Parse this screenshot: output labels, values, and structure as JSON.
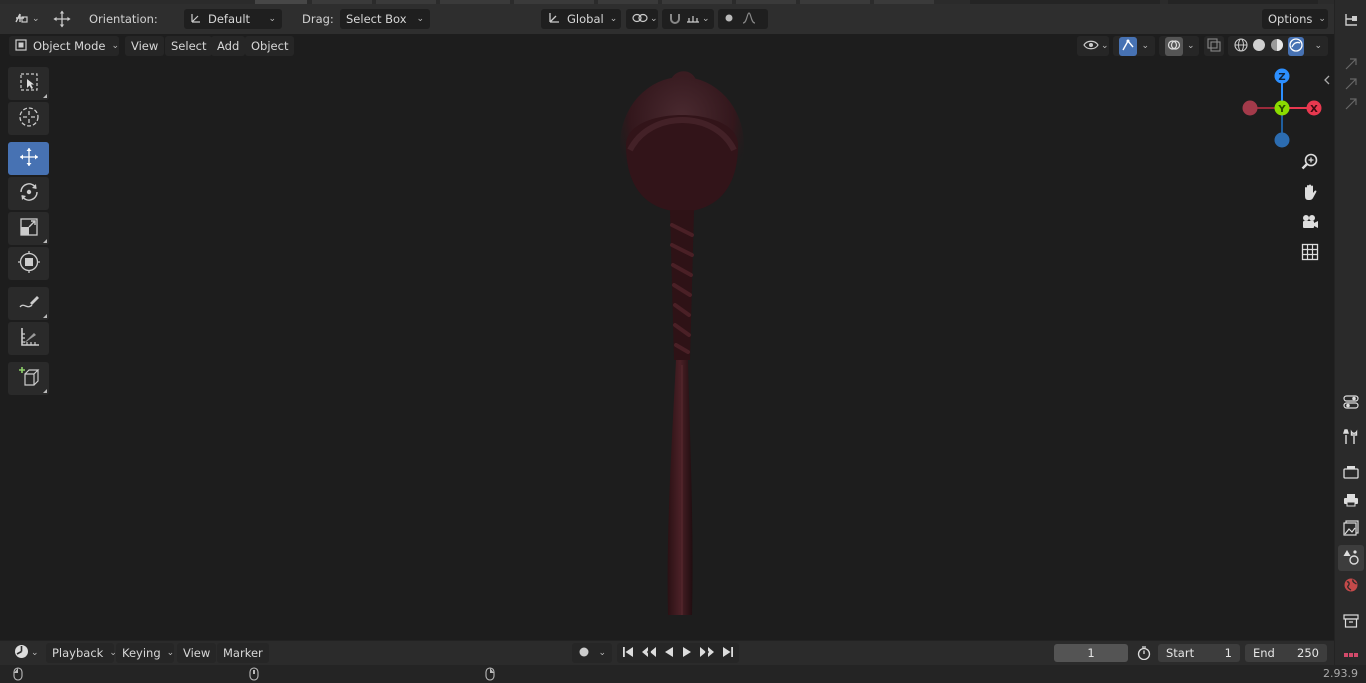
{
  "tool_header": {
    "orientation_label": "Orientation:",
    "orientation_value": "Default",
    "drag_label": "Drag:",
    "drag_value": "Select Box",
    "transform_space": "Global",
    "options_label": "Options"
  },
  "viewport_header": {
    "mode": "Object Mode",
    "menus": [
      "View",
      "Select",
      "Add",
      "Object"
    ]
  },
  "gizmo": {
    "z_label": "Z",
    "y_label": "Y",
    "x_label": "X",
    "colors": {
      "x": "#e8384f",
      "y": "#8bdc00",
      "z": "#2c8fff"
    }
  },
  "timeline": {
    "menus": [
      "Playback",
      "Keying",
      "View",
      "Marker"
    ],
    "current_frame": "1",
    "start_label": "Start",
    "start_value": "1",
    "end_label": "End",
    "end_value": "250"
  },
  "status_bar": {
    "version": "2.93.9"
  },
  "colors": {
    "accent": "#4772b3",
    "hair": "#3b1c22"
  }
}
